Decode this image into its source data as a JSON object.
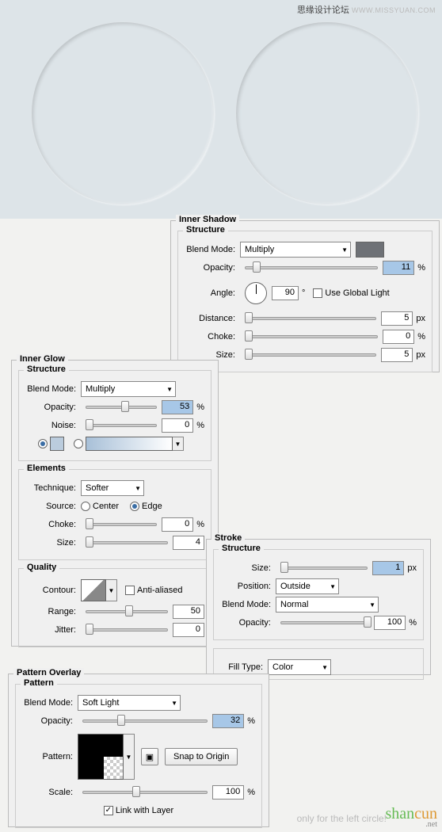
{
  "watermark_top_cn": "思缘设计论坛",
  "watermark_top_url": "WWW.MISSYUAN.COM",
  "inner_shadow": {
    "title": "Inner Shadow",
    "structure_legend": "Structure",
    "blend_mode_label": "Blend Mode:",
    "blend_mode_value": "Multiply",
    "color_swatch": "#6e7176",
    "opacity_label": "Opacity:",
    "opacity_value": "11",
    "opacity_unit": "%",
    "angle_label": "Angle:",
    "angle_value": "90",
    "angle_unit": "°",
    "use_global_label": "Use Global Light",
    "distance_label": "Distance:",
    "distance_value": "5",
    "distance_unit": "px",
    "choke_label": "Choke:",
    "choke_value": "0",
    "choke_unit": "%",
    "size_label": "Size:",
    "size_value": "5",
    "size_unit": "px"
  },
  "inner_glow": {
    "title": "Inner Glow",
    "structure_legend": "Structure",
    "blend_mode_label": "Blend Mode:",
    "blend_mode_value": "Multiply",
    "opacity_label": "Opacity:",
    "opacity_value": "53",
    "opacity_unit": "%",
    "noise_label": "Noise:",
    "noise_value": "0",
    "noise_unit": "%",
    "elements_legend": "Elements",
    "technique_label": "Technique:",
    "technique_value": "Softer",
    "source_label": "Source:",
    "source_center": "Center",
    "source_edge": "Edge",
    "choke_label": "Choke:",
    "choke_value": "0",
    "choke_unit": "%",
    "size_label": "Size:",
    "size_value": "4",
    "quality_legend": "Quality",
    "contour_label": "Contour:",
    "anti_alias_label": "Anti-aliased",
    "range_label": "Range:",
    "range_value": "50",
    "jitter_label": "Jitter:",
    "jitter_value": "0"
  },
  "stroke": {
    "title": "Stroke",
    "structure_legend": "Structure",
    "size_label": "Size:",
    "size_value": "1",
    "size_unit": "px",
    "position_label": "Position:",
    "position_value": "Outside",
    "blend_mode_label": "Blend Mode:",
    "blend_mode_value": "Normal",
    "opacity_label": "Opacity:",
    "opacity_value": "100",
    "opacity_unit": "%",
    "fill_type_label": "Fill Type:",
    "fill_type_value": "Color"
  },
  "pattern_overlay": {
    "title": "Pattern Overlay",
    "pattern_legend": "Pattern",
    "blend_mode_label": "Blend Mode:",
    "blend_mode_value": "Soft Light",
    "opacity_label": "Opacity:",
    "opacity_value": "32",
    "opacity_unit": "%",
    "pattern_label": "Pattern:",
    "snap_label": "Snap to Origin",
    "scale_label": "Scale:",
    "scale_value": "100",
    "scale_unit": "%",
    "link_label": "Link with Layer"
  },
  "foot_note": "only for the left circle!",
  "wm_brand_a": "shan",
  "wm_brand_b": "cun",
  "wm_sub": ".net"
}
